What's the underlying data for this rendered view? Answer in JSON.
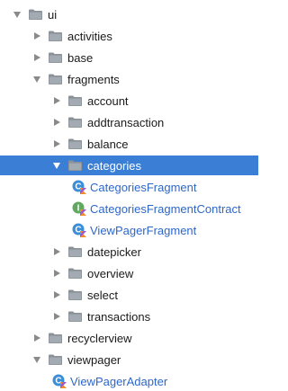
{
  "tree": [
    {
      "label": "ui",
      "kind": "folder",
      "state": "expanded",
      "depth": 0
    },
    {
      "label": "activities",
      "kind": "folder",
      "state": "collapsed",
      "depth": 1
    },
    {
      "label": "base",
      "kind": "folder",
      "state": "collapsed",
      "depth": 1
    },
    {
      "label": "fragments",
      "kind": "folder",
      "state": "expanded",
      "depth": 1
    },
    {
      "label": "account",
      "kind": "folder",
      "state": "collapsed",
      "depth": 2
    },
    {
      "label": "addtransaction",
      "kind": "folder",
      "state": "collapsed",
      "depth": 2
    },
    {
      "label": "balance",
      "kind": "folder",
      "state": "collapsed",
      "depth": 2
    },
    {
      "label": "categories",
      "kind": "folder",
      "state": "expanded",
      "depth": 2,
      "selected": true
    },
    {
      "label": "CategoriesFragment",
      "kind": "kotlin-class",
      "depth": 3
    },
    {
      "label": "CategoriesFragmentContract",
      "kind": "kotlin-interface",
      "depth": 3
    },
    {
      "label": "ViewPagerFragment",
      "kind": "kotlin-class",
      "depth": 3
    },
    {
      "label": "datepicker",
      "kind": "folder",
      "state": "collapsed",
      "depth": 2
    },
    {
      "label": "overview",
      "kind": "folder",
      "state": "collapsed",
      "depth": 2
    },
    {
      "label": "select",
      "kind": "folder",
      "state": "collapsed",
      "depth": 2
    },
    {
      "label": "transactions",
      "kind": "folder",
      "state": "collapsed",
      "depth": 2
    },
    {
      "label": "recyclerview",
      "kind": "folder",
      "state": "collapsed",
      "depth": 1
    },
    {
      "label": "viewpager",
      "kind": "folder",
      "state": "expanded",
      "depth": 1
    },
    {
      "label": "ViewPagerAdapter",
      "kind": "kotlin-class",
      "depth": 2
    }
  ],
  "colors": {
    "selection": "#3a7fd5",
    "class_text": "#2d67c9",
    "kotlin_class_icon": "#3c8fd6",
    "kotlin_interface_icon": "#62a861",
    "folder": "#8a9199"
  }
}
